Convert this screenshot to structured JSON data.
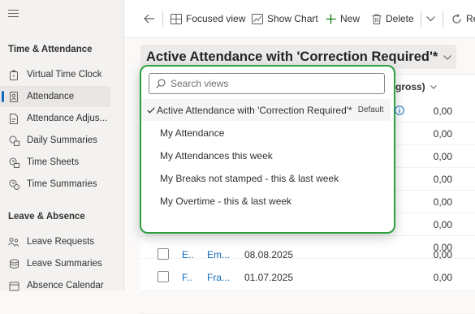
{
  "sidebar": {
    "group1": "Time & Attendance",
    "items1": [
      {
        "label": "Virtual Time Clock",
        "icon": "timer-icon"
      },
      {
        "label": "Attendance",
        "icon": "attendance-icon"
      },
      {
        "label": "Attendance Adjus...",
        "icon": "document-edit-icon"
      },
      {
        "label": "Daily Summaries",
        "icon": "daily-summary-icon"
      },
      {
        "label": "Time Sheets",
        "icon": "time-sheet-icon"
      },
      {
        "label": "Time Summaries",
        "icon": "time-summary-icon"
      }
    ],
    "group2": "Leave & Absence",
    "items2": [
      {
        "label": "Leave Requests",
        "icon": "people-request-icon"
      },
      {
        "label": "Leave Summaries",
        "icon": "stack-icon"
      },
      {
        "label": "Absence Calendar",
        "icon": "calendar-icon"
      }
    ]
  },
  "toolbar": {
    "focused_view": "Focused view",
    "show_chart": "Show Chart",
    "new": "New",
    "delete": "Delete",
    "refresh_partial": "Re"
  },
  "view": {
    "title": "Active Attendance with 'Correction Required'*"
  },
  "grid": {
    "column_header": "(gross)",
    "rows": [
      {
        "value": "0,00"
      },
      {
        "value": "0,00"
      },
      {
        "value": "0,00"
      },
      {
        "value": "0,00"
      },
      {
        "value": "0,00"
      },
      {
        "value": "0,00"
      },
      {
        "value": "0,00"
      },
      {
        "c1": "E..",
        "c2": "Em...",
        "date": "08.08.2025",
        "value": "0,00"
      },
      {
        "c1": "F..",
        "c2": "Fra...",
        "date": "01.07.2025",
        "value": "0,00"
      }
    ]
  },
  "popup": {
    "search_placeholder": "Search views",
    "options": [
      {
        "label": "Active Attendance with 'Correction Required'*",
        "badge": "Default",
        "selected": true
      },
      {
        "label": "My Attendance"
      },
      {
        "label": "My Attendances this week"
      },
      {
        "label": "My Breaks not stamped - this & last week"
      },
      {
        "label": "My Overtime - this & last week"
      }
    ]
  },
  "colors": {
    "accent": "#0f6cbd",
    "popup_border": "#2ea043"
  }
}
